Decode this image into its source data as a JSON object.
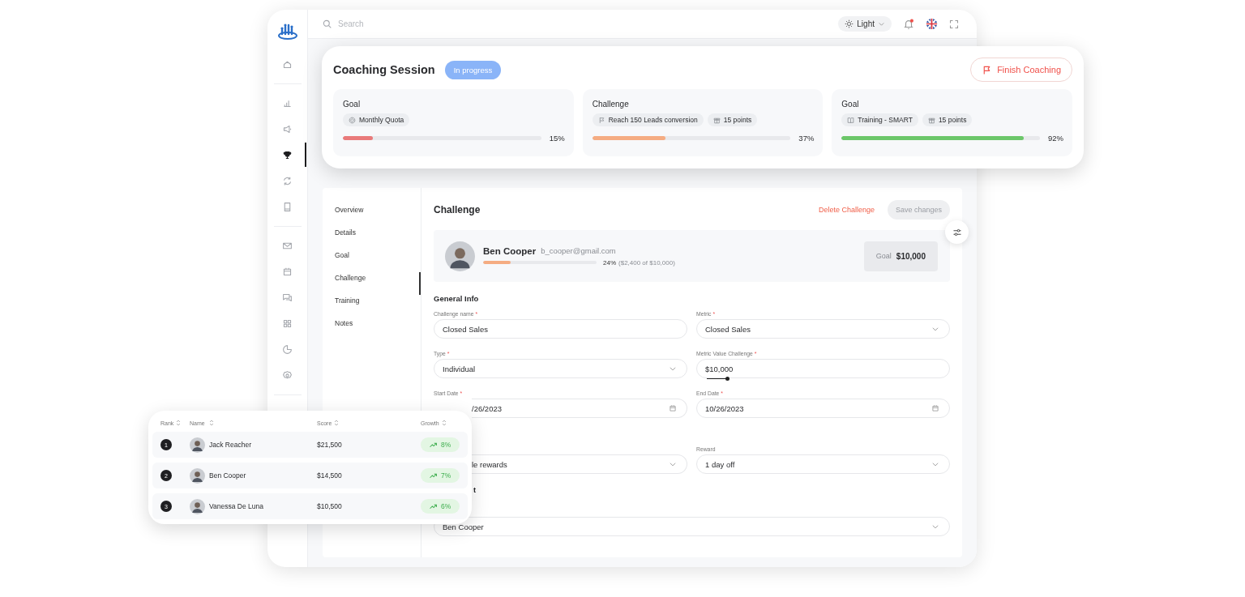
{
  "topbar": {
    "search": {
      "placeholder": "Search"
    },
    "theme": {
      "label": "Light"
    },
    "notifications": {
      "unread": true
    }
  },
  "sidebar": {
    "groups": [
      [
        {
          "selected": false
        }
      ],
      [
        {
          "selected": false
        },
        {
          "selected": false
        },
        {
          "selected": true
        },
        {
          "selected": false
        },
        {
          "selected": false
        }
      ],
      [
        {
          "selected": false
        },
        {
          "selected": false
        },
        {
          "selected": false
        },
        {
          "selected": false
        },
        {
          "selected": false
        },
        {
          "selected": false
        }
      ]
    ]
  },
  "coaching": {
    "title": "Coaching Session",
    "status": "In progress",
    "finish_button": "Finish Coaching",
    "cards": [
      {
        "title": "Goal",
        "tags": [
          {
            "label": "Monthly Quota"
          }
        ],
        "level": 0.15,
        "reading": "15%",
        "color": "#e97a7a"
      },
      {
        "title": "Challenge",
        "tags": [
          {
            "label": "Reach 150 Leads conversion"
          },
          {
            "label": "15 points"
          }
        ],
        "level": 0.37,
        "reading": "37%",
        "color": "#f5ac82"
      },
      {
        "title": "Goal",
        "tags": [
          {
            "label": "Training - SMART"
          },
          {
            "label": "15 points"
          }
        ],
        "level": 0.92,
        "reading": "92%",
        "color": "#6cc76a"
      }
    ]
  },
  "nav": [
    {
      "label": "Overview",
      "selected": false
    },
    {
      "label": "Details",
      "selected": false
    },
    {
      "label": "Goal",
      "selected": false
    },
    {
      "label": "Challenge",
      "selected": true
    },
    {
      "label": "Training",
      "selected": false
    },
    {
      "label": "Notes",
      "selected": false
    }
  ],
  "challenge": {
    "title": "Challenge",
    "delete_link": "Delete Challenge",
    "save_button": {
      "label": "Save changes",
      "disabled": true
    },
    "profile": {
      "name": "Ben Cooper",
      "email": "b_cooper@gmail.com",
      "level": 0.24,
      "reading": "24%",
      "reading_detail": "($2,400 of $10,000)",
      "goal_label": "Goal",
      "goal_value": "$10,000"
    },
    "form": [
      {
        "kind": "heading",
        "text": "General Info"
      },
      {
        "kind": "fields",
        "fields": [
          {
            "label": "Challenge name",
            "required_mark": "*",
            "kind": "text",
            "value": "Closed Sales"
          },
          {
            "label": "Metric",
            "required_mark": "*",
            "kind": "select",
            "value": "Closed Sales"
          }
        ]
      },
      {
        "kind": "fields",
        "fields": [
          {
            "label": "Type",
            "required_mark": "*",
            "kind": "select",
            "value": "Individual"
          },
          {
            "label": "Metric Value Challenge",
            "required_mark": "*",
            "kind": "slider",
            "value": "$10,000",
            "level": 1
          }
        ]
      },
      {
        "kind": "fields",
        "fields": [
          {
            "label": "Start Date",
            "required_mark": "*",
            "kind": "date",
            "value": "/26/2023"
          },
          {
            "label": "End Date",
            "required_mark": "*",
            "kind": "date",
            "value": "10/26/2023"
          }
        ]
      },
      {
        "kind": "fields",
        "fields": [
          {
            "kind": "select",
            "value": "le rewards"
          },
          {
            "label": "Reward",
            "kind": "select",
            "value": "1 day off"
          }
        ]
      },
      {
        "kind": "heading",
        "text": "t"
      },
      {
        "kind": "fields",
        "fields": [
          {
            "kind": "select",
            "value": "Ben Cooper"
          }
        ]
      }
    ]
  },
  "leaderboard": {
    "columns": [
      "Rank",
      "Name",
      "Score",
      "Growth"
    ],
    "rows": [
      {
        "rank": "1",
        "name": "Jack Reacher",
        "score": "$21,500",
        "growth": "8%"
      },
      {
        "rank": "2",
        "name": "Ben Cooper",
        "score": "$14,500",
        "growth": "7%"
      },
      {
        "rank": "3",
        "name": "Vanessa De Luna",
        "score": "$10,500",
        "growth": "6%"
      }
    ]
  }
}
